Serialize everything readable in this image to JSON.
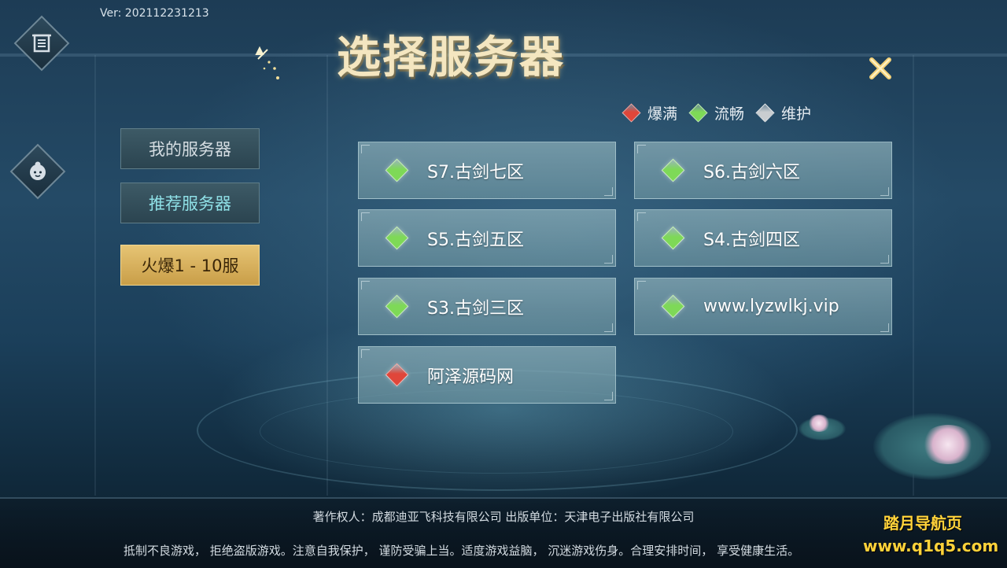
{
  "version": "Ver: 202112231213",
  "title": "选择服务器",
  "top_left_icon": "notice-icon",
  "left_icon": "avatar-icon",
  "close_icon": "close-x-icon",
  "legend": [
    {
      "label": "爆满",
      "color": "#e0463a"
    },
    {
      "label": "流畅",
      "color": "#7ed957"
    },
    {
      "label": "维护",
      "color": "#c9cdd0"
    }
  ],
  "sidebar": {
    "items": [
      {
        "label": "我的服务器"
      },
      {
        "label": "推荐服务器"
      },
      {
        "label": "火爆1 - 10服"
      }
    ],
    "active_index": 2
  },
  "servers": [
    {
      "name": "S7.古剑七区",
      "status_color": "#7ed957"
    },
    {
      "name": "S6.古剑六区",
      "status_color": "#7ed957"
    },
    {
      "name": "S5.古剑五区",
      "status_color": "#7ed957"
    },
    {
      "name": "S4.古剑四区",
      "status_color": "#7ed957"
    },
    {
      "name": "S3.古剑三区",
      "status_color": "#7ed957"
    },
    {
      "name": "www.lyzwlkj.vip",
      "status_color": "#7ed957"
    },
    {
      "name": "阿泽源码网",
      "status_color": "#e0463a"
    }
  ],
  "footer": {
    "copyright": "著作权人：成都迪亚飞科技有限公司   出版单位：天津电子出版社有限公司",
    "health_notice": "抵制不良游戏，  拒绝盗版游戏。注意自我保护，  谨防受骗上当。适度游戏益脑，  沉迷游戏伤身。合理安排时间，  享受健康生活。"
  },
  "watermark": {
    "line1": "踏月导航页",
    "line2": "www.q1q5.com"
  }
}
